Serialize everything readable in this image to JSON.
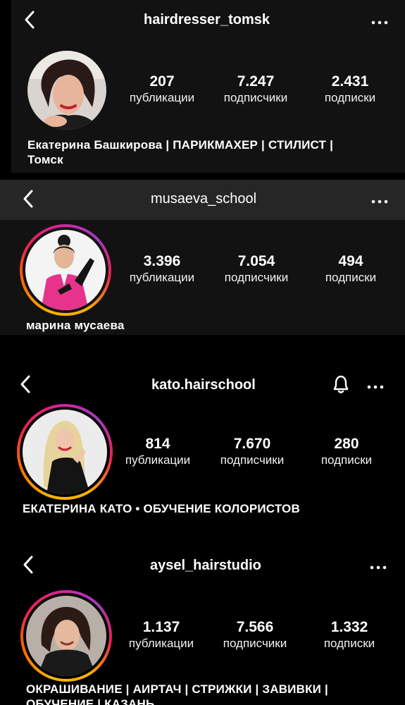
{
  "profiles": [
    {
      "username": "hairdresser_tomsk",
      "stats": [
        {
          "value": "207",
          "label": "публикации"
        },
        {
          "value": "7.247",
          "label": "подписчики"
        },
        {
          "value": "2.431",
          "label": "подписки"
        }
      ],
      "bio_line1": "Екатерина Башкирова | ПАРИКМАХЕР | СТИЛИСТ |",
      "bio_line2": "Томск"
    },
    {
      "username": "musaeva_school",
      "stats": [
        {
          "value": "3.396",
          "label": "публикации"
        },
        {
          "value": "7.054",
          "label": "подписчики"
        },
        {
          "value": "494",
          "label": "подписки"
        }
      ],
      "bio_line1": "марина мусаева"
    },
    {
      "username": "kato.hairschool",
      "stats": [
        {
          "value": "814",
          "label": "публикации"
        },
        {
          "value": "7.670",
          "label": "подписчики"
        },
        {
          "value": "280",
          "label": "подписки"
        }
      ],
      "bio_line1": "ЕКАТЕРИНА КАТО • ОБУЧЕНИЕ КОЛОРИСТОВ"
    },
    {
      "username": "aysel_hairstudio",
      "stats": [
        {
          "value": "1.137",
          "label": "публикации"
        },
        {
          "value": "7.566",
          "label": "подписчики"
        },
        {
          "value": "1.332",
          "label": "подписки"
        }
      ],
      "bio_line1": "ОКРАШИВАНИЕ | АИРТАЧ | СТРИЖКИ | ЗАВИВКИ |",
      "bio_line2": "ОБУЧЕНИЕ | КАЗАНЬ"
    }
  ],
  "icons": {
    "back": "chevron-left-icon",
    "more": "more-horizontal-icon",
    "notifications": "bell-icon"
  },
  "colors": {
    "background": "#000000",
    "card": "#121212",
    "header_bar": "#262626",
    "text": "#ffffff",
    "story_ring_start": "#f9b500",
    "story_ring_end": "#d6249f"
  }
}
